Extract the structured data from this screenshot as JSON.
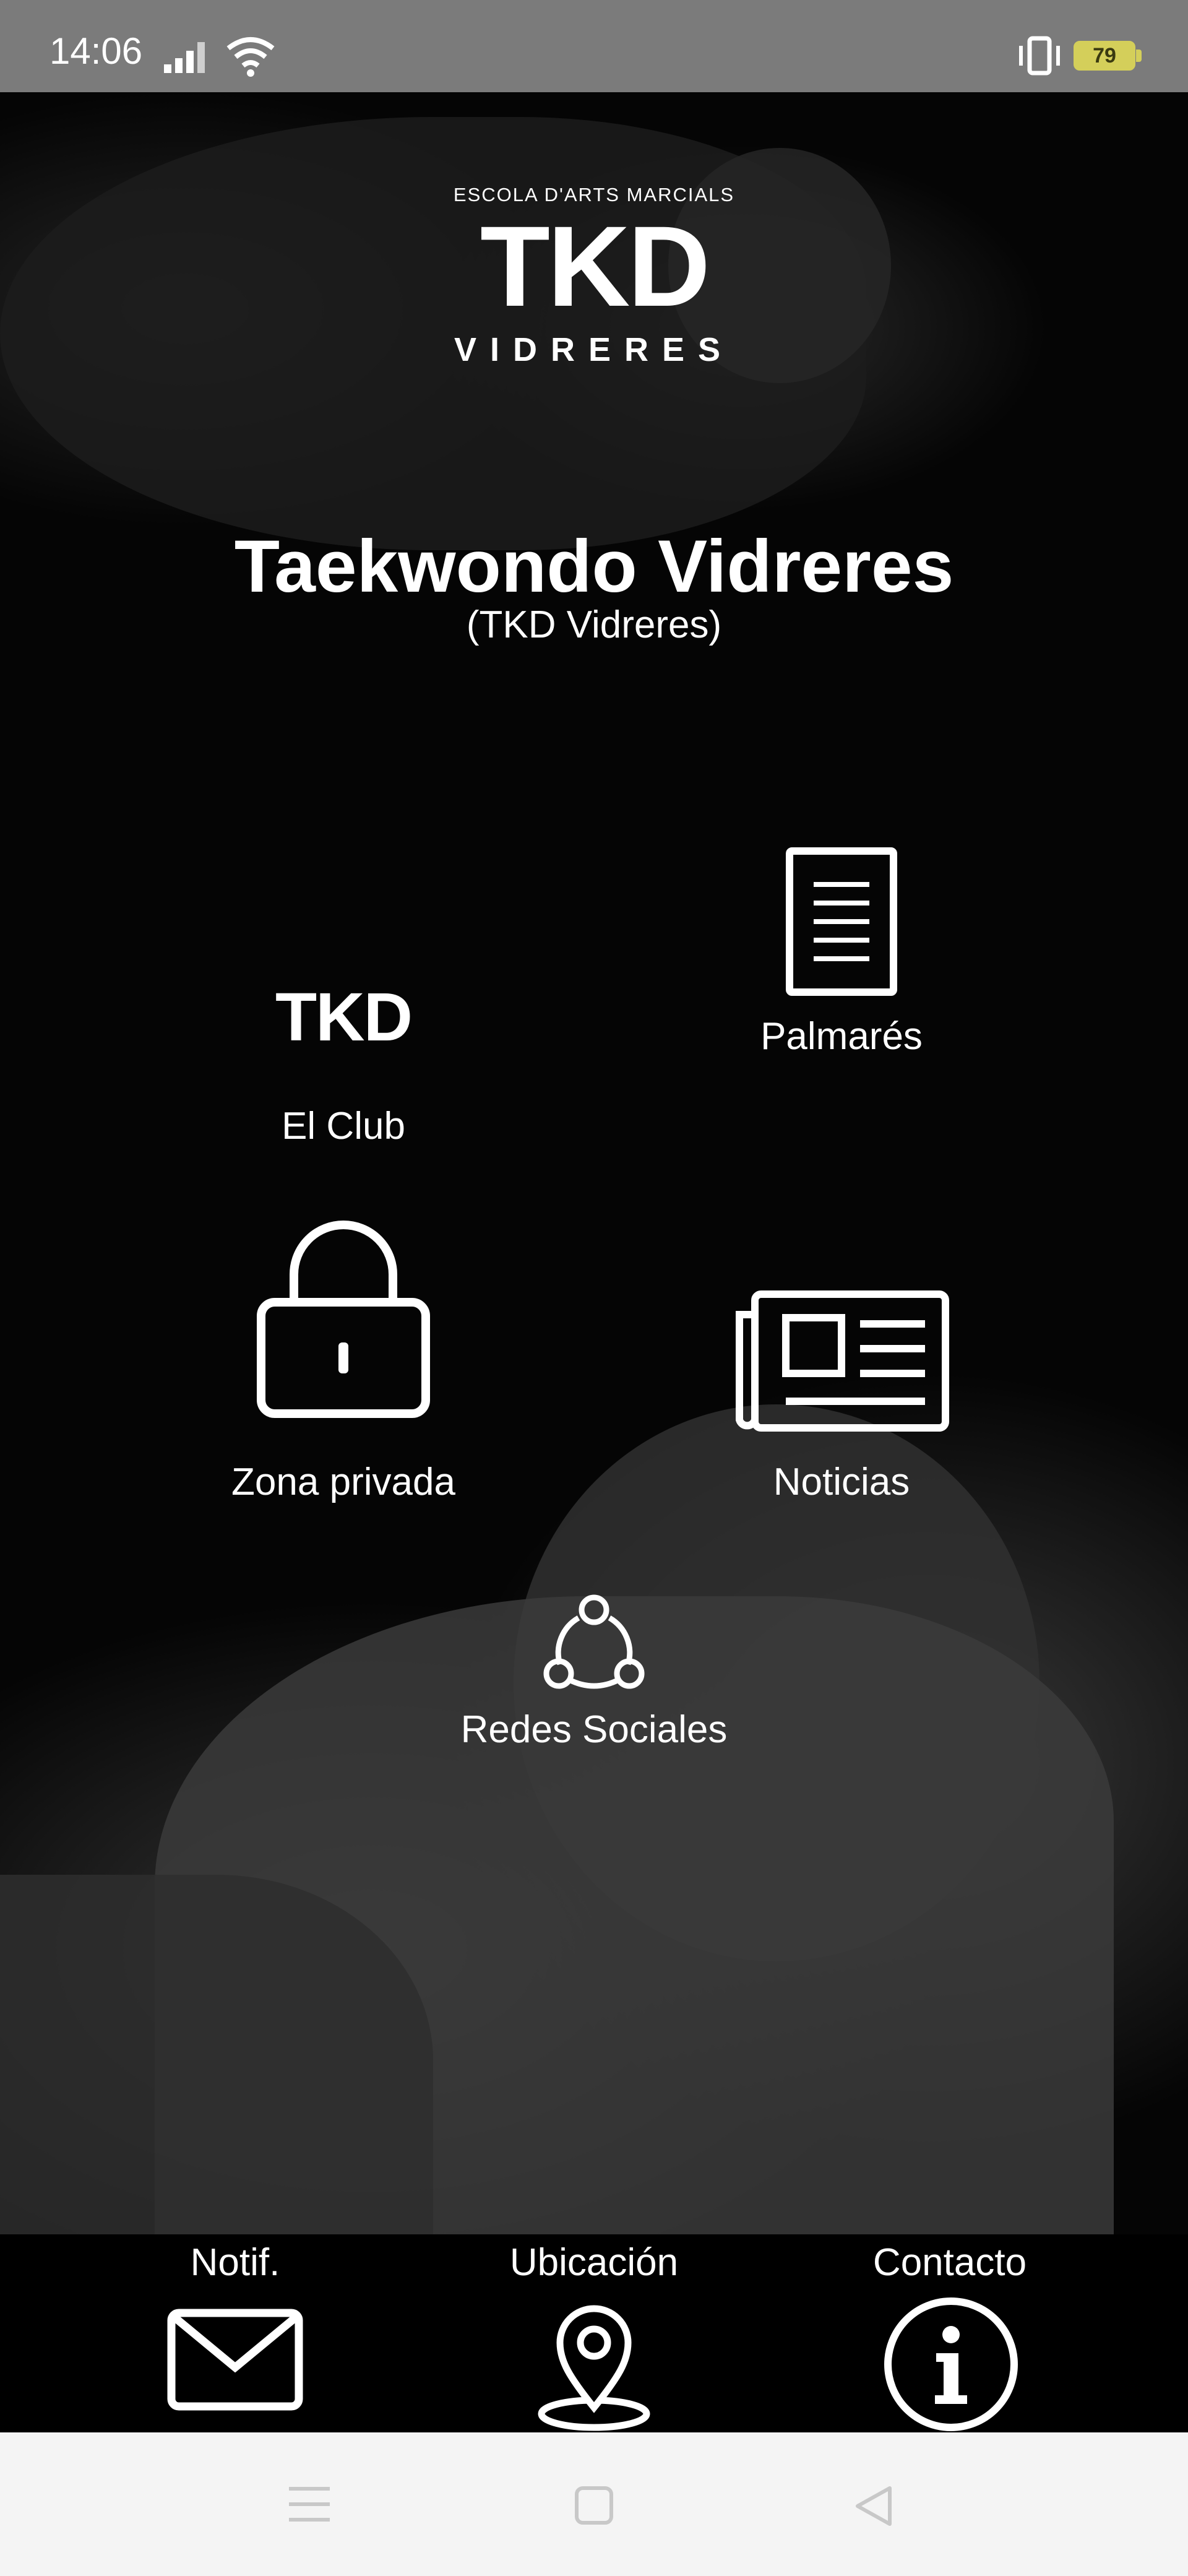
{
  "status": {
    "time": "14:06",
    "battery": "79"
  },
  "logo": {
    "top": "ESCOLA D'ARTS MARCIALS",
    "main": "TKD",
    "sub": "VIDRERES"
  },
  "title": "Taekwondo Vidreres",
  "subtitle": "(TKD Vidreres)",
  "tiles": {
    "club": {
      "icon_text": "TKD",
      "label": "El Club",
      "icon": "tkd-logo-icon"
    },
    "palmares": {
      "label": "Palmarés",
      "icon": "document-icon"
    },
    "zona": {
      "label": "Zona privada",
      "icon": "lock-icon"
    },
    "noticias": {
      "label": "Noticias",
      "icon": "newspaper-icon"
    },
    "redes": {
      "label": "Redes Sociales",
      "icon": "share-network-icon"
    }
  },
  "bottom": {
    "notif": {
      "label": "Notif.",
      "icon": "mail-icon"
    },
    "ubicacion": {
      "label": "Ubicación",
      "icon": "location-pin-icon"
    },
    "contacto": {
      "label": "Contacto",
      "icon": "info-icon"
    }
  },
  "colors": {
    "statusbar": "#7b7b7b",
    "background": "#000000",
    "battery": "#d4cf5a",
    "navbar": "#f4f4f4",
    "nav_icons": "#c8c8c8"
  }
}
